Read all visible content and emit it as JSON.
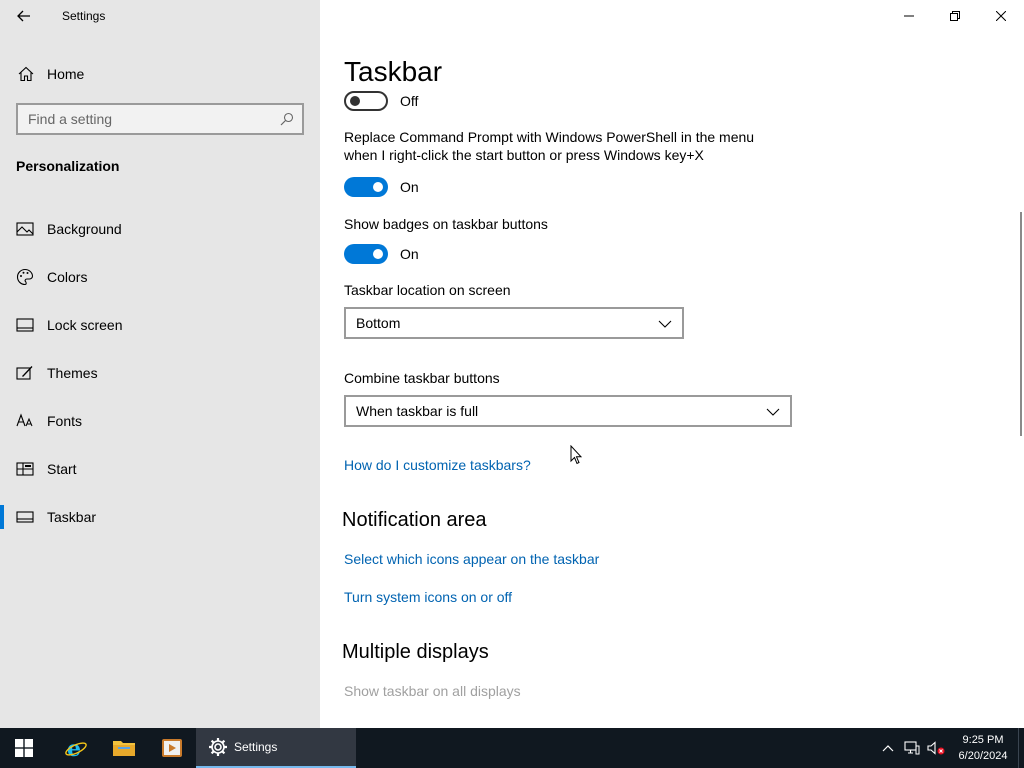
{
  "window": {
    "title": "Settings"
  },
  "sidebar": {
    "home_label": "Home",
    "search_placeholder": "Find a setting",
    "section_heading": "Personalization",
    "items": [
      {
        "label": "Background",
        "icon": "picture-icon"
      },
      {
        "label": "Colors",
        "icon": "palette-icon"
      },
      {
        "label": "Lock screen",
        "icon": "lock-screen-icon"
      },
      {
        "label": "Themes",
        "icon": "themes-icon"
      },
      {
        "label": "Fonts",
        "icon": "fonts-icon"
      },
      {
        "label": "Start",
        "icon": "start-icon"
      },
      {
        "label": "Taskbar",
        "icon": "taskbar-icon",
        "active": true
      }
    ]
  },
  "main": {
    "page_title": "Taskbar",
    "settings": {
      "top_toggle_state": "Off",
      "replace_cmd_label": "Replace Command Prompt with Windows PowerShell in the menu when I right-click the start button or press Windows key+X",
      "replace_cmd_state": "On",
      "badges_label": "Show badges on taskbar buttons",
      "badges_state": "On",
      "location_label": "Taskbar location on screen",
      "location_value": "Bottom",
      "combine_label": "Combine taskbar buttons",
      "combine_value": "When taskbar is full",
      "customize_link": "How do I customize taskbars?"
    },
    "notification_area": {
      "heading": "Notification area",
      "link_icons": "Select which icons appear on the taskbar",
      "link_system": "Turn system icons on or off"
    },
    "multiple_displays": {
      "heading": "Multiple displays",
      "show_all_label": "Show taskbar on all displays"
    }
  },
  "taskbar": {
    "settings_label": "Settings",
    "time": "9:25 PM",
    "date": "6/20/2024"
  },
  "colors": {
    "accent": "#0078d7",
    "link": "#0063b1",
    "sidebar_bg": "#e6e6e6",
    "taskbar_bg": "#101820"
  }
}
